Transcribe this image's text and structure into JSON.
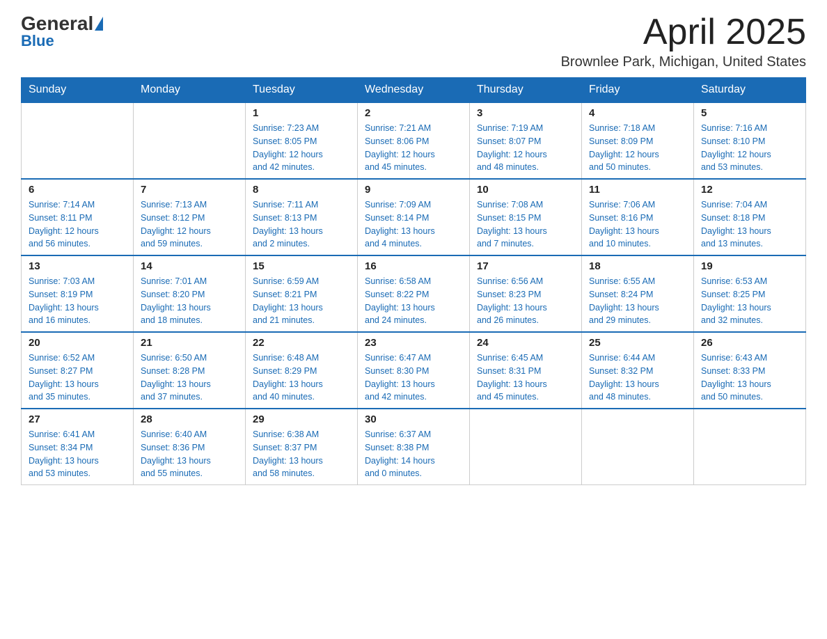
{
  "header": {
    "logo_general": "General",
    "logo_blue": "Blue",
    "month_title": "April 2025",
    "location": "Brownlee Park, Michigan, United States"
  },
  "weekdays": [
    "Sunday",
    "Monday",
    "Tuesday",
    "Wednesday",
    "Thursday",
    "Friday",
    "Saturday"
  ],
  "weeks": [
    [
      {
        "day": "",
        "info": []
      },
      {
        "day": "",
        "info": []
      },
      {
        "day": "1",
        "info": [
          "Sunrise: 7:23 AM",
          "Sunset: 8:05 PM",
          "Daylight: 12 hours",
          "and 42 minutes."
        ]
      },
      {
        "day": "2",
        "info": [
          "Sunrise: 7:21 AM",
          "Sunset: 8:06 PM",
          "Daylight: 12 hours",
          "and 45 minutes."
        ]
      },
      {
        "day": "3",
        "info": [
          "Sunrise: 7:19 AM",
          "Sunset: 8:07 PM",
          "Daylight: 12 hours",
          "and 48 minutes."
        ]
      },
      {
        "day": "4",
        "info": [
          "Sunrise: 7:18 AM",
          "Sunset: 8:09 PM",
          "Daylight: 12 hours",
          "and 50 minutes."
        ]
      },
      {
        "day": "5",
        "info": [
          "Sunrise: 7:16 AM",
          "Sunset: 8:10 PM",
          "Daylight: 12 hours",
          "and 53 minutes."
        ]
      }
    ],
    [
      {
        "day": "6",
        "info": [
          "Sunrise: 7:14 AM",
          "Sunset: 8:11 PM",
          "Daylight: 12 hours",
          "and 56 minutes."
        ]
      },
      {
        "day": "7",
        "info": [
          "Sunrise: 7:13 AM",
          "Sunset: 8:12 PM",
          "Daylight: 12 hours",
          "and 59 minutes."
        ]
      },
      {
        "day": "8",
        "info": [
          "Sunrise: 7:11 AM",
          "Sunset: 8:13 PM",
          "Daylight: 13 hours",
          "and 2 minutes."
        ]
      },
      {
        "day": "9",
        "info": [
          "Sunrise: 7:09 AM",
          "Sunset: 8:14 PM",
          "Daylight: 13 hours",
          "and 4 minutes."
        ]
      },
      {
        "day": "10",
        "info": [
          "Sunrise: 7:08 AM",
          "Sunset: 8:15 PM",
          "Daylight: 13 hours",
          "and 7 minutes."
        ]
      },
      {
        "day": "11",
        "info": [
          "Sunrise: 7:06 AM",
          "Sunset: 8:16 PM",
          "Daylight: 13 hours",
          "and 10 minutes."
        ]
      },
      {
        "day": "12",
        "info": [
          "Sunrise: 7:04 AM",
          "Sunset: 8:18 PM",
          "Daylight: 13 hours",
          "and 13 minutes."
        ]
      }
    ],
    [
      {
        "day": "13",
        "info": [
          "Sunrise: 7:03 AM",
          "Sunset: 8:19 PM",
          "Daylight: 13 hours",
          "and 16 minutes."
        ]
      },
      {
        "day": "14",
        "info": [
          "Sunrise: 7:01 AM",
          "Sunset: 8:20 PM",
          "Daylight: 13 hours",
          "and 18 minutes."
        ]
      },
      {
        "day": "15",
        "info": [
          "Sunrise: 6:59 AM",
          "Sunset: 8:21 PM",
          "Daylight: 13 hours",
          "and 21 minutes."
        ]
      },
      {
        "day": "16",
        "info": [
          "Sunrise: 6:58 AM",
          "Sunset: 8:22 PM",
          "Daylight: 13 hours",
          "and 24 minutes."
        ]
      },
      {
        "day": "17",
        "info": [
          "Sunrise: 6:56 AM",
          "Sunset: 8:23 PM",
          "Daylight: 13 hours",
          "and 26 minutes."
        ]
      },
      {
        "day": "18",
        "info": [
          "Sunrise: 6:55 AM",
          "Sunset: 8:24 PM",
          "Daylight: 13 hours",
          "and 29 minutes."
        ]
      },
      {
        "day": "19",
        "info": [
          "Sunrise: 6:53 AM",
          "Sunset: 8:25 PM",
          "Daylight: 13 hours",
          "and 32 minutes."
        ]
      }
    ],
    [
      {
        "day": "20",
        "info": [
          "Sunrise: 6:52 AM",
          "Sunset: 8:27 PM",
          "Daylight: 13 hours",
          "and 35 minutes."
        ]
      },
      {
        "day": "21",
        "info": [
          "Sunrise: 6:50 AM",
          "Sunset: 8:28 PM",
          "Daylight: 13 hours",
          "and 37 minutes."
        ]
      },
      {
        "day": "22",
        "info": [
          "Sunrise: 6:48 AM",
          "Sunset: 8:29 PM",
          "Daylight: 13 hours",
          "and 40 minutes."
        ]
      },
      {
        "day": "23",
        "info": [
          "Sunrise: 6:47 AM",
          "Sunset: 8:30 PM",
          "Daylight: 13 hours",
          "and 42 minutes."
        ]
      },
      {
        "day": "24",
        "info": [
          "Sunrise: 6:45 AM",
          "Sunset: 8:31 PM",
          "Daylight: 13 hours",
          "and 45 minutes."
        ]
      },
      {
        "day": "25",
        "info": [
          "Sunrise: 6:44 AM",
          "Sunset: 8:32 PM",
          "Daylight: 13 hours",
          "and 48 minutes."
        ]
      },
      {
        "day": "26",
        "info": [
          "Sunrise: 6:43 AM",
          "Sunset: 8:33 PM",
          "Daylight: 13 hours",
          "and 50 minutes."
        ]
      }
    ],
    [
      {
        "day": "27",
        "info": [
          "Sunrise: 6:41 AM",
          "Sunset: 8:34 PM",
          "Daylight: 13 hours",
          "and 53 minutes."
        ]
      },
      {
        "day": "28",
        "info": [
          "Sunrise: 6:40 AM",
          "Sunset: 8:36 PM",
          "Daylight: 13 hours",
          "and 55 minutes."
        ]
      },
      {
        "day": "29",
        "info": [
          "Sunrise: 6:38 AM",
          "Sunset: 8:37 PM",
          "Daylight: 13 hours",
          "and 58 minutes."
        ]
      },
      {
        "day": "30",
        "info": [
          "Sunrise: 6:37 AM",
          "Sunset: 8:38 PM",
          "Daylight: 14 hours",
          "and 0 minutes."
        ]
      },
      {
        "day": "",
        "info": []
      },
      {
        "day": "",
        "info": []
      },
      {
        "day": "",
        "info": []
      }
    ]
  ]
}
